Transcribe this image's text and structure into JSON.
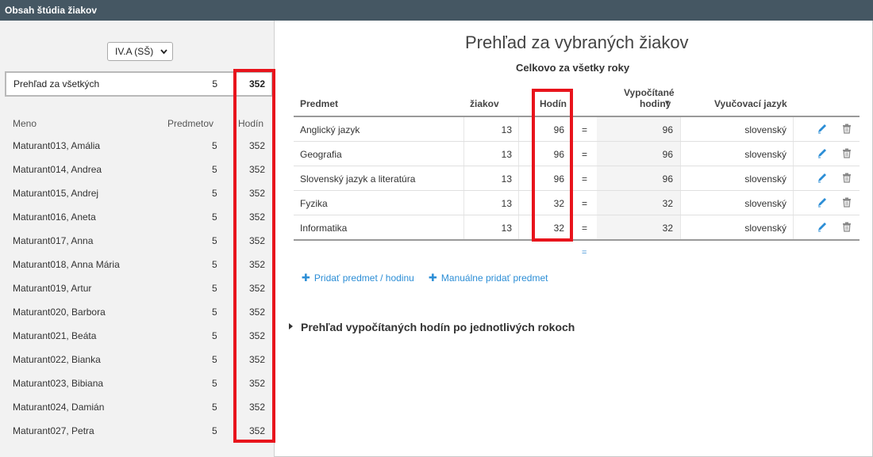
{
  "window": {
    "title": "Obsah štúdia žiakov"
  },
  "left": {
    "class_select": {
      "value": "IV.A (SŠ)"
    },
    "summary": {
      "label": "Prehľad za všetkých",
      "count": "5",
      "hours": "352"
    },
    "headers": {
      "name": "Meno",
      "subjects": "Predmetov",
      "hours": "Hodín"
    },
    "students": [
      {
        "name": "Maturant013, Amália",
        "count": "5",
        "hours": "352"
      },
      {
        "name": "Maturant014, Andrea",
        "count": "5",
        "hours": "352"
      },
      {
        "name": "Maturant015, Andrej",
        "count": "5",
        "hours": "352"
      },
      {
        "name": "Maturant016, Aneta",
        "count": "5",
        "hours": "352"
      },
      {
        "name": "Maturant017, Anna",
        "count": "5",
        "hours": "352"
      },
      {
        "name": "Maturant018, Anna Mária",
        "count": "5",
        "hours": "352"
      },
      {
        "name": "Maturant019, Artur",
        "count": "5",
        "hours": "352"
      },
      {
        "name": "Maturant020, Barbora",
        "count": "5",
        "hours": "352"
      },
      {
        "name": "Maturant021, Beáta",
        "count": "5",
        "hours": "352"
      },
      {
        "name": "Maturant022, Bianka",
        "count": "5",
        "hours": "352"
      },
      {
        "name": "Maturant023, Bibiana",
        "count": "5",
        "hours": "352"
      },
      {
        "name": "Maturant024, Damián",
        "count": "5",
        "hours": "352"
      },
      {
        "name": "Maturant027, Petra",
        "count": "5",
        "hours": "352"
      }
    ]
  },
  "main": {
    "title": "Prehľad za vybraných žiakov",
    "subtitle": "Celkovo za všetky roky",
    "columns": {
      "subject": "Predmet",
      "students": "žiakov",
      "hours": "Hodín",
      "calc_line1": "Vypočítané",
      "calc_line2": "hodiny",
      "sort_arrow": "▾",
      "language": "Vyučovací jazyk"
    },
    "rows": [
      {
        "subject": "Anglický jazyk",
        "students": "13",
        "hours": "96",
        "eq": "=",
        "calc": "96",
        "language": "slovenský"
      },
      {
        "subject": "Geografia",
        "students": "13",
        "hours": "96",
        "eq": "=",
        "calc": "96",
        "language": "slovenský"
      },
      {
        "subject": "Slovenský jazyk a literatúra",
        "students": "13",
        "hours": "96",
        "eq": "=",
        "calc": "96",
        "language": "slovenský"
      },
      {
        "subject": "Fyzika",
        "students": "13",
        "hours": "32",
        "eq": "=",
        "calc": "32",
        "language": "slovenský"
      },
      {
        "subject": "Informatika",
        "students": "13",
        "hours": "32",
        "eq": "=",
        "calc": "32",
        "language": "slovenský"
      }
    ],
    "total_eq": "=",
    "links": {
      "add_subject": "Pridať predmet / hodinu",
      "manual_add": "Manuálne pridať predmet"
    },
    "expander_label": "Prehľad vypočítaných hodín po jednotlivých rokoch"
  },
  "colors": {
    "titlebar": "#455763",
    "accent": "#2c8ed6",
    "highlight": "#e8141c"
  }
}
